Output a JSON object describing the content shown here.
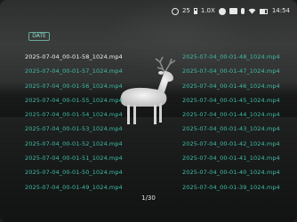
{
  "status_bar": {
    "battery_level": "25",
    "zoom": "1.0X",
    "time": "14:54",
    "icons": [
      "gear-icon",
      "battery-small-icon",
      "record-icon",
      "camera-icon",
      "mic-icon",
      "wifi-icon",
      "battery-icon"
    ]
  },
  "folder_tag": "DATE",
  "files_left": [
    {
      "name": "2025-07-04_00-01-58_1024.mp4",
      "selected": true
    },
    {
      "name": "2025-07-04_00-01-57_1024.mp4"
    },
    {
      "name": "2025-07-04_00-01-56_1024.mp4"
    },
    {
      "name": "2025-07-04_00-01-55_1024.mp4"
    },
    {
      "name": "2025-07-04_00-01-54_1024.mp4"
    },
    {
      "name": "2025-07-04_00-01-53_1024.mp4"
    },
    {
      "name": "2025-07-04_00-01-52_1024.mp4"
    },
    {
      "name": "2025-07-04_00-01-51_1024.mp4"
    },
    {
      "name": "2025-07-04_00-01-50_1024.mp4"
    },
    {
      "name": "2025-07-04_00-01-49_1024.mp4"
    }
  ],
  "files_right": [
    {
      "name": "2025-07-04_00-01-48_1024.mp4"
    },
    {
      "name": "2025-07-04_00-01-47_1024.mp4"
    },
    {
      "name": "2025-07-04_00-01-46_1024.mp4"
    },
    {
      "name": "2025-07-04_00-01-45_1024.mp4"
    },
    {
      "name": "2025-07-04_00-01-44_1024.mp4"
    },
    {
      "name": "2025-07-04_00-01-43_1024.mp4"
    },
    {
      "name": "2025-07-04_00-01-42_1024.mp4"
    },
    {
      "name": "2025-07-04_00-01-41_1024.mp4"
    },
    {
      "name": "2025-07-04_00-01-40_1024.mp4"
    },
    {
      "name": "2025-07-04_00-01-39_1024.mp4"
    }
  ],
  "pagination": "1/30",
  "colors": {
    "file_text": "#3fbfa6",
    "selected_text": "#f0f0f0",
    "tag_border": "#78d2be"
  }
}
